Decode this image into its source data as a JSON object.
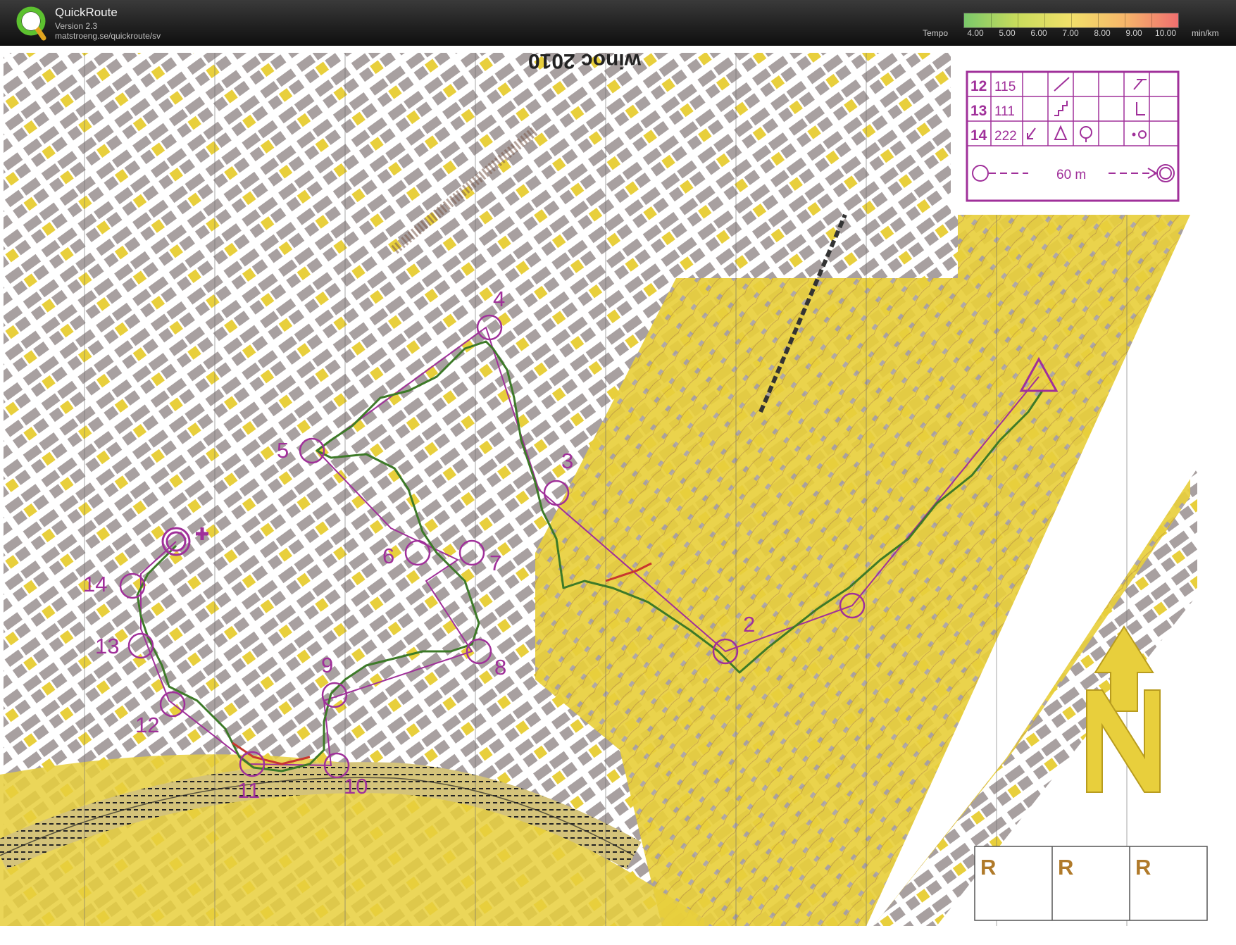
{
  "app": {
    "name": "QuickRoute",
    "version": "Version 2.3",
    "url": "matstroeng.se/quickroute/sv"
  },
  "legend": {
    "title": "Tempo",
    "ticks": [
      "4.00",
      "5.00",
      "6.00",
      "7.00",
      "8.00",
      "9.00",
      "10.00"
    ],
    "unit": "min/km",
    "colors": {
      "fast": "#7ac86a",
      "mid": "#f2e06a",
      "slow": "#ef6f6f"
    }
  },
  "map": {
    "header_text": "winoc 2010",
    "control_description": [
      {
        "number": "12",
        "code": "115"
      },
      {
        "number": "13",
        "code": "111"
      },
      {
        "number": "14",
        "code": "222"
      }
    ],
    "finish_distance": "60 m",
    "controls": [
      "2",
      "3",
      "4",
      "5",
      "6",
      "7",
      "8",
      "9",
      "10",
      "11",
      "12",
      "13",
      "14"
    ],
    "refreshment_labels": [
      "R",
      "R",
      "R"
    ],
    "north_label": "N",
    "colors": {
      "course": "#a0309a",
      "route": "#3d7a28",
      "route_slow": "#c8362f",
      "open_land": "#e8cf3c",
      "building": "#a8a0a0",
      "road": "#ffffff"
    }
  }
}
